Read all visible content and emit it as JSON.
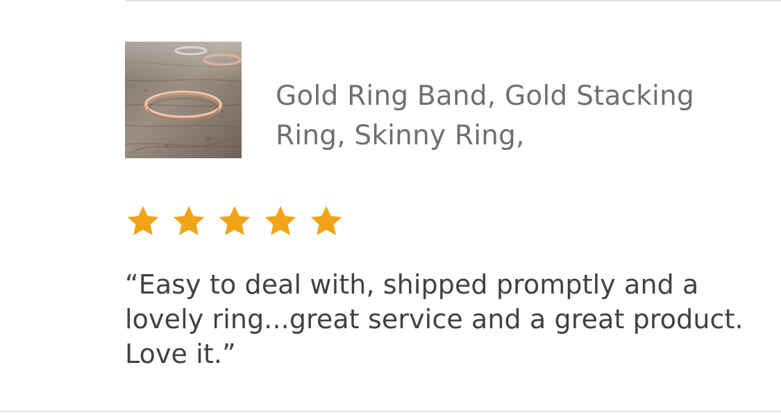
{
  "review": {
    "product": {
      "title": "Gold Ring Band, Gold Stacking Ring, Skinny Ring,",
      "image_subject": "rose-gold-stacking-ring-photo"
    },
    "rating": {
      "stars": 5,
      "max": 5,
      "star_color": "#f1a418"
    },
    "quote": "“Easy to deal with, shipped promptly and a lovely ring...great service and a great product. Love it.”"
  },
  "colors": {
    "divider": "#e1e1e1",
    "title_text": "#6f6f6f",
    "review_text": "#414141"
  }
}
